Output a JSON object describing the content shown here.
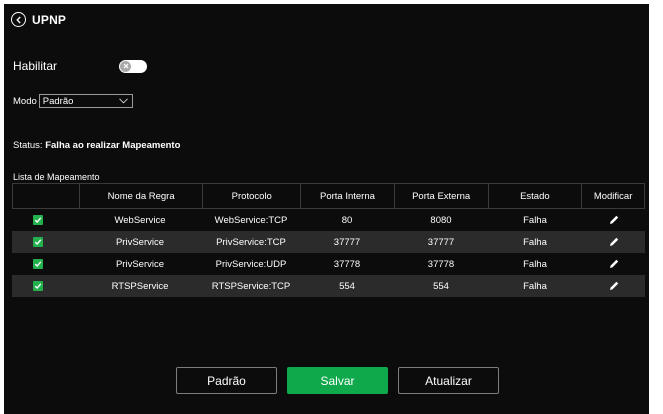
{
  "header": {
    "title": "UPNP",
    "close": "×"
  },
  "enable": {
    "label": "Habilitar",
    "state": false
  },
  "mode": {
    "label": "Modo",
    "value": "Padrão"
  },
  "status": {
    "label": "Status:",
    "value": "Falha ao realizar Mapeamento"
  },
  "list": {
    "title": "Lista de Mapeamento",
    "columns": [
      "",
      "Nome da Regra",
      "Protocolo",
      "Porta Interna",
      "Porta Externa",
      "Estado",
      "Modificar"
    ],
    "rows": [
      {
        "checked": true,
        "name": "WebService",
        "protocol": "WebService:TCP",
        "internal": "80",
        "external": "8080",
        "state": "Falha"
      },
      {
        "checked": true,
        "name": "PrivService",
        "protocol": "PrivService:TCP",
        "internal": "37777",
        "external": "37777",
        "state": "Falha"
      },
      {
        "checked": true,
        "name": "PrivService",
        "protocol": "PrivService:UDP",
        "internal": "37778",
        "external": "37778",
        "state": "Falha"
      },
      {
        "checked": true,
        "name": "RTSPService",
        "protocol": "RTSPService:TCP",
        "internal": "554",
        "external": "554",
        "state": "Falha"
      }
    ]
  },
  "buttons": {
    "default": "Padrão",
    "save": "Salvar",
    "refresh": "Atualizar"
  },
  "colors": {
    "background": "#0c0c0c",
    "accent": "#0fa84a",
    "checkbox": "#23b14d",
    "row_alt": "#2b2b2b"
  },
  "icons": [
    "back-icon",
    "close-icon",
    "toggle-off-icon",
    "chevron-down-icon",
    "checkbox-checked-icon",
    "edit-pencil-icon"
  ]
}
